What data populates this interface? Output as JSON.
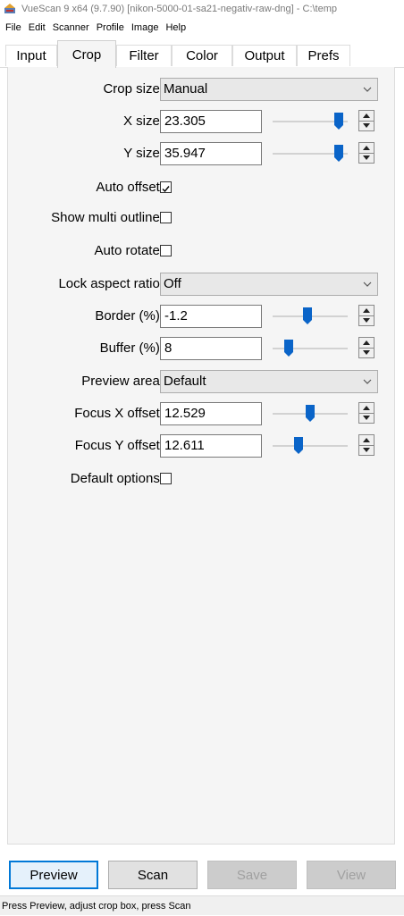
{
  "window": {
    "title": "VueScan 9 x64 (9.7.90) [nikon-5000-01-sa21-negativ-raw-dng] - C:\\temp",
    "app_icon": "vuescan-scanner-icon"
  },
  "menu": [
    "File",
    "Edit",
    "Scanner",
    "Profile",
    "Image",
    "Help"
  ],
  "tabs": [
    "Input",
    "Crop",
    "Filter",
    "Color",
    "Output",
    "Prefs"
  ],
  "active_tab": "Crop",
  "crop": {
    "crop_size": {
      "label": "Crop size:",
      "value": "Manual"
    },
    "x_size": {
      "label": "X size:",
      "value": "23.305",
      "slider_level": 0.88
    },
    "y_size": {
      "label": "Y size:",
      "value": "35.947",
      "slider_level": 0.88
    },
    "auto_offset": {
      "label": "Auto offset:",
      "checked": true
    },
    "show_multi_outline": {
      "label": "Show multi outline:",
      "checked": false
    },
    "auto_rotate": {
      "label": "Auto rotate:",
      "checked": false
    },
    "lock_aspect_ratio": {
      "label": "Lock aspect ratio:",
      "value": "Off"
    },
    "border": {
      "label": "Border (%):",
      "value": "-1.2",
      "slider_level": 0.47
    },
    "buffer": {
      "label": "Buffer (%):",
      "value": "8",
      "slider_level": 0.21
    },
    "preview_area": {
      "label": "Preview area:",
      "value": "Default"
    },
    "focus_x_offset": {
      "label": "Focus X offset:",
      "value": "12.529",
      "slider_level": 0.5
    },
    "focus_y_offset": {
      "label": "Focus Y offset:",
      "value": "12.611",
      "slider_level": 0.34
    },
    "default_options": {
      "label": "Default options:",
      "checked": false
    }
  },
  "buttons": {
    "preview": "Preview",
    "scan": "Scan",
    "save": "Save",
    "view": "View"
  },
  "status": "Press Preview, adjust crop box, press Scan",
  "colors": {
    "accent": "#0078d7",
    "slider_thumb": "#0a64c8"
  }
}
